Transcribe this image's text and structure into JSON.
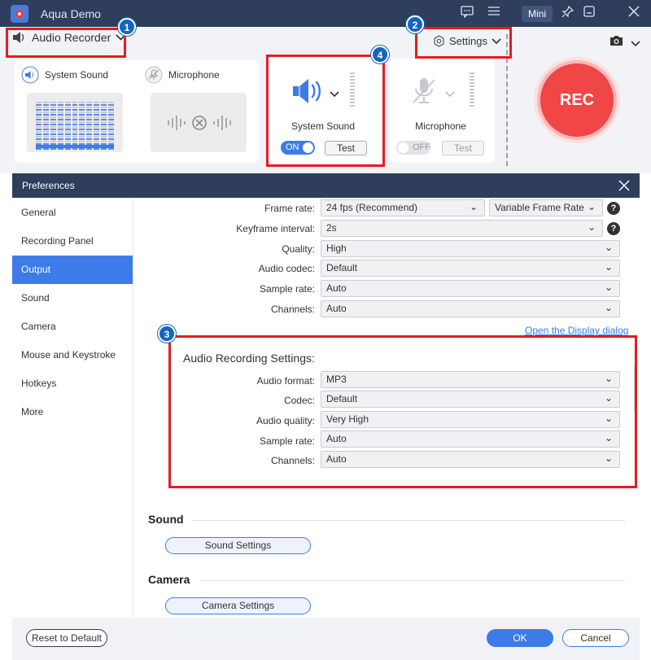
{
  "window": {
    "title": "Aqua Demo",
    "mini_label": "Mini",
    "icons": [
      "chat-icon",
      "menu-icon",
      "pin-icon",
      "minimize-icon",
      "close-icon"
    ]
  },
  "recorder": {
    "mode_label": "Audio Recorder",
    "settings_label": "Settings",
    "system_sound_label": "System Sound",
    "microphone_label": "Microphone",
    "card_system_sound_label": "System Sound",
    "card_microphone_label": "Microphone",
    "system_toggle": "ON",
    "mic_toggle": "OFF",
    "test_label": "Test",
    "rec_label": "REC"
  },
  "badges": [
    "1",
    "2",
    "3",
    "4"
  ],
  "preferences": {
    "title": "Preferences",
    "sidebar": [
      {
        "label": "General",
        "active": false
      },
      {
        "label": "Recording Panel",
        "active": false
      },
      {
        "label": "Output",
        "active": true
      },
      {
        "label": "Sound",
        "active": false
      },
      {
        "label": "Camera",
        "active": false
      },
      {
        "label": "Mouse and Keystroke",
        "active": false
      },
      {
        "label": "Hotkeys",
        "active": false
      },
      {
        "label": "More",
        "active": false
      }
    ],
    "video_rows": [
      {
        "label": "Frame rate:",
        "value": "24 fps (Recommend)",
        "value2": "Variable Frame Rate"
      },
      {
        "label": "Keyframe interval:",
        "value": "2s"
      },
      {
        "label": "Quality:",
        "value": "High"
      },
      {
        "label": "Audio codec:",
        "value": "Default"
      },
      {
        "label": "Sample rate:",
        "value": "Auto"
      },
      {
        "label": "Channels:",
        "value": "Auto"
      }
    ],
    "display_link": "Open the Display dialog",
    "audio_section_title": "Audio Recording Settings:",
    "audio_rows": [
      {
        "label": "Audio format:",
        "value": "MP3"
      },
      {
        "label": "Codec:",
        "value": "Default"
      },
      {
        "label": "Audio quality:",
        "value": "Very High"
      },
      {
        "label": "Sample rate:",
        "value": "Auto"
      },
      {
        "label": "Channels:",
        "value": "Auto"
      }
    ],
    "sound_section": "Sound",
    "sound_button": "Sound Settings",
    "camera_section": "Camera",
    "camera_button": "Camera Settings",
    "reset_label": "Reset to Default",
    "ok_label": "OK",
    "cancel_label": "Cancel",
    "help_glyph": "?"
  },
  "colors": {
    "titlebar": "#2e3e5c",
    "accent": "#3d7be8",
    "rec": "#f04646",
    "highlight_box": "#e51c23",
    "badge": "#1565c0"
  }
}
